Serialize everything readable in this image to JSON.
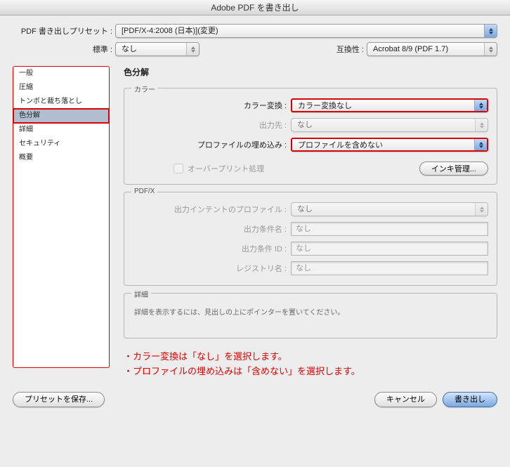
{
  "window": {
    "title": "Adobe PDF を書き出し"
  },
  "top": {
    "preset_label": "PDF 書き出しプリセット :",
    "preset_value": "[PDF/X-4:2008 (日本)](変更)",
    "standard_label": "標準 :",
    "standard_value": "なし",
    "compat_label": "互換性 :",
    "compat_value": "Acrobat 8/9 (PDF 1.7)"
  },
  "sidebar": {
    "items": [
      "一般",
      "圧縮",
      "トンボと裁ち落とし",
      "色分解",
      "詳細",
      "セキュリティ",
      "概要"
    ],
    "selected_index": 3
  },
  "main": {
    "heading": "色分解",
    "color_group_label": "カラー",
    "color_conversion_label": "カラー変換 :",
    "color_conversion_value": "カラー変換なし",
    "output_dest_label": "出力先 :",
    "output_dest_value": "なし",
    "profile_embed_label": "プロファイルの埋め込み :",
    "profile_embed_value": "プロファイルを含めない",
    "overprint_simulate_label": "オーバープリント処理",
    "ink_manager_button": "インキ管理...",
    "pdfx_group_label": "PDF/X",
    "output_intent_label": "出力インテントのプロファイル :",
    "output_intent_value": "なし",
    "output_cond_name_label": "出力条件名 :",
    "output_cond_name_value": "なし",
    "output_cond_id_label": "出力条件 ID :",
    "output_cond_id_value": "なし",
    "registry_name_label": "レジストリ名 :",
    "registry_name_value": "なし",
    "detail_group_label": "詳細",
    "detail_hint": "詳細を表示するには、見出しの上にポインターを置いてください。"
  },
  "annotation": {
    "line1": "・カラー変換は「なし」を選択します。",
    "line2": "・プロファイルの埋め込みは「含めない」を選択します。"
  },
  "footer": {
    "save_preset": "プリセットを保存...",
    "cancel": "キャンセル",
    "export": "書き出し"
  }
}
